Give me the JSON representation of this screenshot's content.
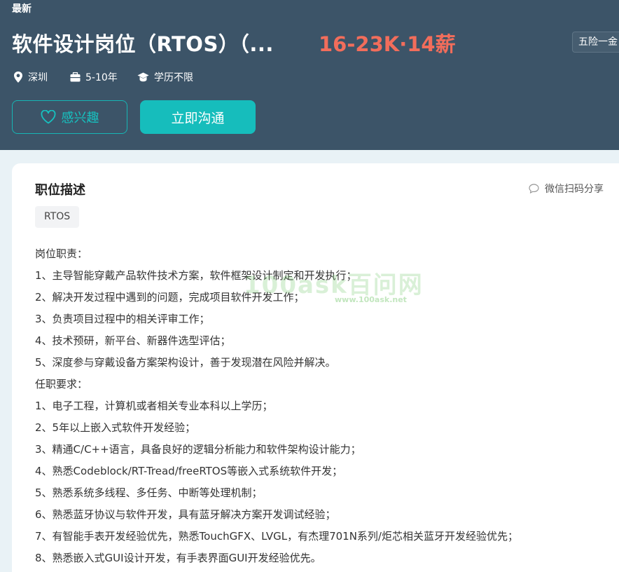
{
  "header": {
    "latest_label": "最新",
    "job_title": "软件设计岗位（RTOS）（...",
    "salary": "16-23K·14薪",
    "benefit_tag": "五险一金",
    "meta": {
      "city": "深圳",
      "experience": "5-10年",
      "education": "学历不限"
    },
    "interest_button": "感兴趣",
    "chat_button": "立即沟通"
  },
  "description": {
    "section_title": "职位描述",
    "share_label": "微信扫码分享",
    "skill_tags": [
      "RTOS"
    ],
    "lines": [
      "岗位职责：",
      "1、主导智能穿戴产品软件技术方案，软件框架设计制定和开发执行；",
      "2、解决开发过程中遇到的问题，完成项目软件开发工作；",
      "3、负责项目过程中的相关评审工作；",
      "4、技术预研，新平台、新器件选型评估；",
      "5、深度参与穿戴设备方案架构设计，善于发现潜在风险并解决。",
      "任职要求：",
      "1、电子工程，计算机或者相关专业本科以上学历；",
      "2、5年以上嵌入式软件开发经验；",
      "3、精通C/C++语言，具备良好的逻辑分析能力和软件架构设计能力；",
      "4、熟悉Codeblock/RT-Tread/freeRTOS等嵌入式系统软件开发；",
      "5、熟悉系统多线程、多任务、中断等处理机制；",
      "6、熟悉蓝牙协议与软件开发，具有蓝牙解决方案开发调试经验；",
      "7、有智能手表开发经验优先，熟悉TouchGFX、LVGL，有杰理701N系列/炬芯相关蓝牙开发经验优先；",
      "8、熟悉嵌入式GUI设计开发，有手表界面GUI开发经验优先。"
    ]
  },
  "watermark": {
    "main": "100ask百问网",
    "sub": "www.100ask.net"
  },
  "colors": {
    "header_bg": "#3c5468",
    "accent_teal": "#16bdbc",
    "salary": "#f26d5b",
    "page_bg": "#e9f2f6"
  },
  "icons": {
    "city": "location-pin-icon",
    "experience": "briefcase-icon",
    "education": "graduation-cap-icon",
    "interest": "heart-icon",
    "share": "chat-bubble-icon"
  }
}
